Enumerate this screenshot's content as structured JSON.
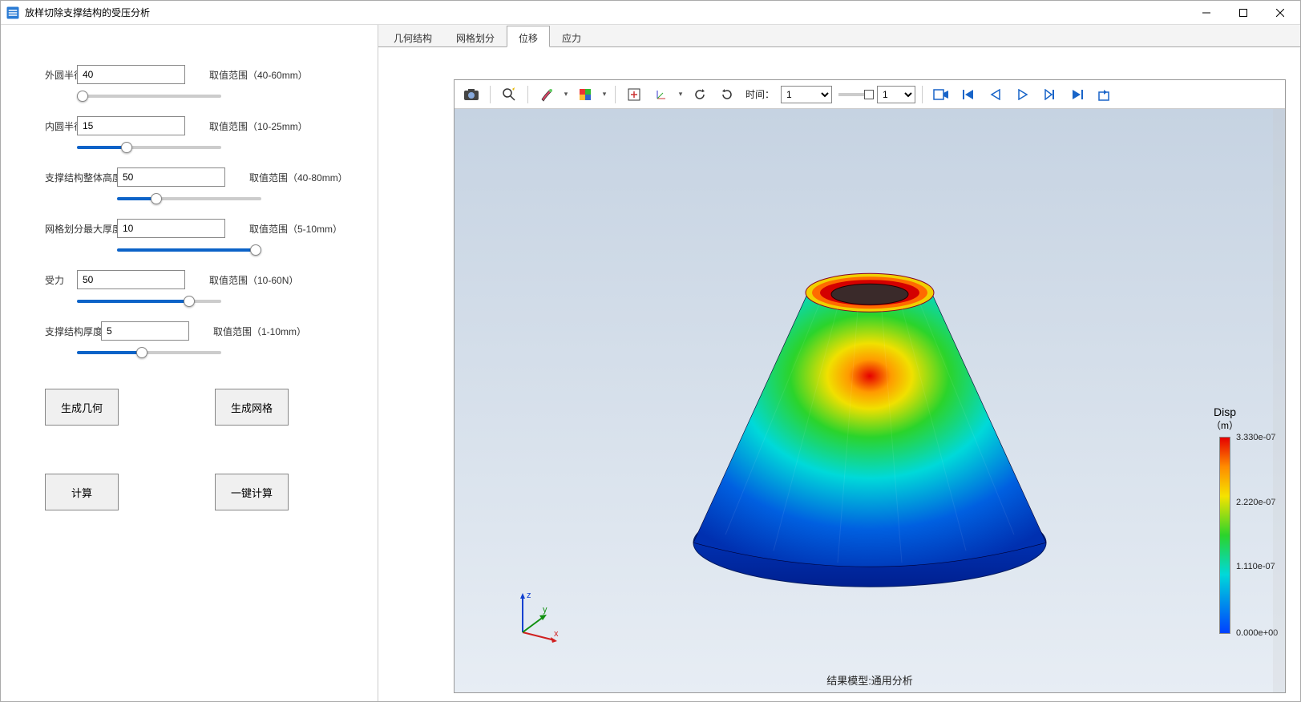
{
  "window": {
    "title": "放样切除支撑结构的受压分析"
  },
  "params": {
    "outer_radius": {
      "label": "外圆半径",
      "value": "40",
      "range": "取值范围（40-60mm）",
      "min": 40,
      "max": 60
    },
    "inner_radius": {
      "label": "内圆半径",
      "value": "15",
      "range": "取值范围（10-25mm）",
      "min": 10,
      "max": 25
    },
    "height": {
      "label": "支撑结构整体高度",
      "value": "50",
      "range": "取值范围（40-80mm）",
      "min": 40,
      "max": 80
    },
    "mesh_max": {
      "label": "网格划分最大厚度",
      "value": "10",
      "range": "取值范围（5-10mm）",
      "min": 5,
      "max": 10
    },
    "force": {
      "label": "受力",
      "value": "50",
      "range": "取值范围（10-60N）",
      "min": 10,
      "max": 60
    },
    "thickness": {
      "label": "支撑结构厚度",
      "value": "5",
      "range": "取值范围（1-10mm）",
      "min": 1,
      "max": 10
    }
  },
  "buttons": {
    "gen_geom": "生成几何",
    "gen_mesh": "生成网格",
    "compute": "计算",
    "one_click": "一键计算"
  },
  "tabs": {
    "geom": "几何结构",
    "mesh": "网格划分",
    "disp": "位移",
    "stress": "应力",
    "active": "disp"
  },
  "toolbar": {
    "time_label": "时间：",
    "time_value": "1",
    "step_value": "1"
  },
  "viewer": {
    "footer": "结果模型:通用分析",
    "axes": {
      "x": "x",
      "y": "y",
      "z": "z"
    }
  },
  "legend": {
    "title1": "Disp",
    "title2": "（m）",
    "ticks": [
      "3.330e-07",
      "2.220e-07",
      "1.110e-07",
      "0.000e+00"
    ]
  }
}
